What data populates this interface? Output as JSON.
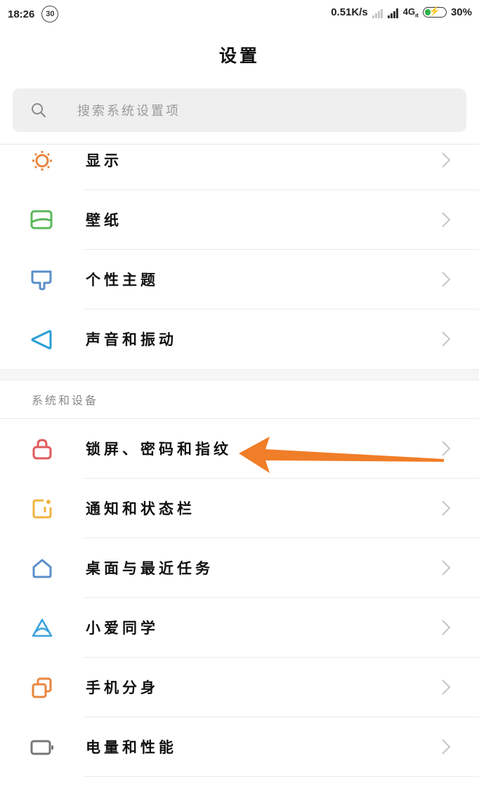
{
  "status_bar": {
    "time": "18:26",
    "badge": "30",
    "net_speed": "0.51K/s",
    "network_type": "4G",
    "network_sub": "ıt",
    "battery_percent": "30%",
    "battery_level": 0.3
  },
  "header": {
    "title": "设置"
  },
  "search": {
    "placeholder": "搜索系统设置项"
  },
  "group_display": {
    "items": [
      {
        "label": "显示",
        "icon": "sun-icon",
        "color": "#e8853e"
      },
      {
        "label": "壁纸",
        "icon": "wallpaper-icon",
        "color": "#5cb85c"
      },
      {
        "label": "个性主题",
        "icon": "theme-icon",
        "color": "#5a8fc9"
      },
      {
        "label": "声音和振动",
        "icon": "sound-icon",
        "color": "#2a9fd6"
      }
    ]
  },
  "group_system": {
    "header": "系统和设备",
    "items": [
      {
        "label": "锁屏、密码和指纹",
        "icon": "lock-icon",
        "color": "#e05a5a"
      },
      {
        "label": "通知和状态栏",
        "icon": "notification-icon",
        "color": "#f0b340"
      },
      {
        "label": "桌面与最近任务",
        "icon": "home-icon",
        "color": "#5a8fc9"
      },
      {
        "label": "小爱同学",
        "icon": "xiaoai-icon",
        "color": "#3aa3dc"
      },
      {
        "label": "手机分身",
        "icon": "dual-app-icon",
        "color": "#e8853e"
      },
      {
        "label": "电量和性能",
        "icon": "battery-icon",
        "color": "#777777"
      }
    ]
  },
  "colors": {
    "annotation_arrow": "#f07d28",
    "chevron": "#c4c4c4"
  }
}
